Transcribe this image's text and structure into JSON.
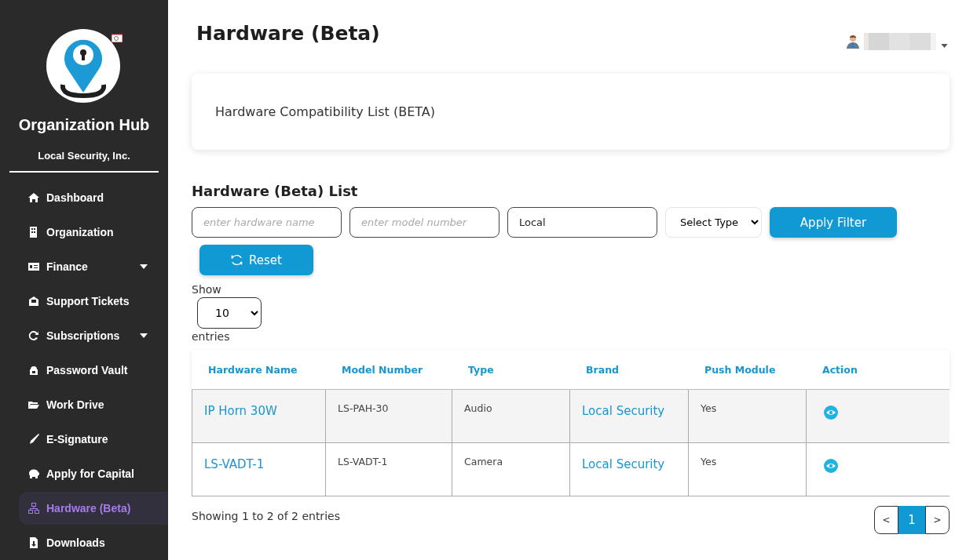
{
  "sidebar": {
    "title": "Organization Hub",
    "company": "Local Security, Inc.",
    "items": [
      {
        "label": "Dashboard",
        "selected": false,
        "has_submenu": false
      },
      {
        "label": "Organization",
        "selected": false,
        "has_submenu": false
      },
      {
        "label": "Finance",
        "selected": false,
        "has_submenu": true
      },
      {
        "label": "Support Tickets",
        "selected": false,
        "has_submenu": false
      },
      {
        "label": "Subscriptions",
        "selected": false,
        "has_submenu": true
      },
      {
        "label": "Password Vault",
        "selected": false,
        "has_submenu": false
      },
      {
        "label": "Work Drive",
        "selected": false,
        "has_submenu": false
      },
      {
        "label": "E-Signature",
        "selected": false,
        "has_submenu": false
      },
      {
        "label": "Apply for Capital",
        "selected": false,
        "has_submenu": false
      },
      {
        "label": "Hardware (Beta)",
        "selected": true,
        "has_submenu": false
      },
      {
        "label": "Downloads",
        "selected": false,
        "has_submenu": false
      }
    ]
  },
  "page": {
    "title": "Hardware (Beta)"
  },
  "card": {
    "title": "Hardware Compatibility List (BETA)"
  },
  "list": {
    "title": "Hardware (Beta) List",
    "filters": {
      "hardware_name": {
        "placeholder": "enter hardware name"
      },
      "model_number": {
        "placeholder": "enter model number"
      },
      "brand": {
        "value": "Local"
      },
      "type": {
        "value": "Select Type"
      },
      "apply": "Apply Filter",
      "reset": "Reset"
    },
    "show_label": "Show",
    "page_size": "10",
    "entries_label": "entries",
    "table": {
      "columns": [
        "Hardware Name",
        "Model Number",
        "Type",
        "Brand",
        "Push Module",
        "Action"
      ],
      "rows": [
        {
          "hardware_name": "IP Horn 30W",
          "model_number": "LS-PAH-30",
          "type": "Audio",
          "brand": "Local Security",
          "push_module": "Yes"
        },
        {
          "hardware_name": "LS-VADT-1",
          "model_number": "LS-VADT-1",
          "type": "Camera",
          "brand": "Local Security",
          "push_module": "Yes"
        }
      ]
    },
    "summary": "Showing 1 to 2 of 2 entries",
    "pagination": {
      "prev": "<",
      "pages": [
        {
          "label": "1",
          "selected": true
        }
      ],
      "next": ">"
    }
  }
}
